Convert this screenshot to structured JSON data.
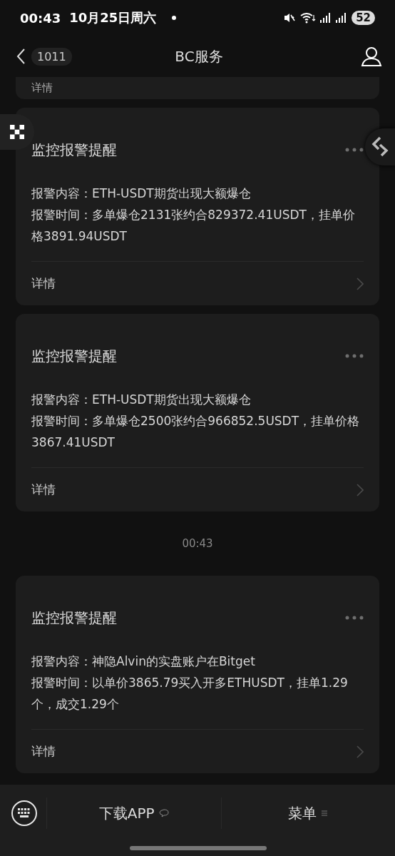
{
  "status_bar": {
    "time": "00:43",
    "date": "10月25日周六",
    "battery": "52"
  },
  "header": {
    "back_count": "1011",
    "title": "BC服务"
  },
  "messages": [
    {
      "kind": "stub",
      "detail_label": "详情"
    },
    {
      "kind": "alert",
      "title": "监控报警提醒",
      "lines": [
        "报警内容：ETH-USDT期货出现大额爆仓",
        "报警时间：多单爆仓2131张约合829372.41USDT，挂单价格3891.94USDT"
      ],
      "detail_label": "详情"
    },
    {
      "kind": "alert",
      "title": "监控报警提醒",
      "lines": [
        "报警内容：ETH-USDT期货出现大额爆仓",
        "报警时间：多单爆仓2500张约合966852.5USDT，挂单价格3867.41USDT"
      ],
      "detail_label": "详情"
    },
    {
      "kind": "time",
      "text": "00:43"
    },
    {
      "kind": "alert",
      "title": "监控报警提醒",
      "lines": [
        "报警内容：神隐Alvin的实盘账户在Bitget",
        "报警时间：以单价3865.79买入开多ETHUSDT，挂单1.29个，成交1.29个"
      ],
      "detail_label": "详情"
    }
  ],
  "bottom_bar": {
    "download_label": "下载APP",
    "menu_label": "菜单"
  }
}
